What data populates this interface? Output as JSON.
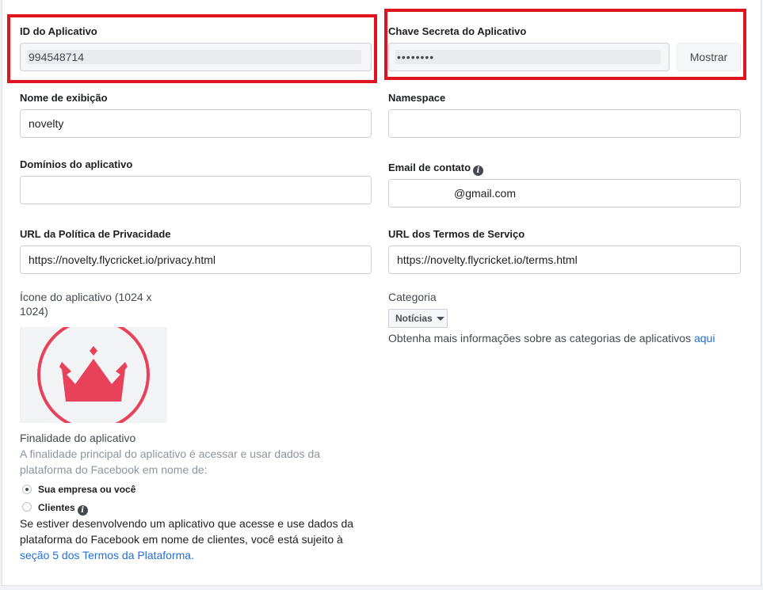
{
  "app_id": {
    "label": "ID do Aplicativo",
    "value": "994548714"
  },
  "app_secret": {
    "label": "Chave Secreta do Aplicativo",
    "value": "••••••••",
    "button": "Mostrar"
  },
  "display_name": {
    "label": "Nome de exibição",
    "value": "novelty"
  },
  "namespace": {
    "label": "Namespace",
    "value": ""
  },
  "app_domains": {
    "label": "Domínios do aplicativo",
    "value": ""
  },
  "contact_email": {
    "label": "Email de contato",
    "value": "@gmail.com"
  },
  "privacy_url": {
    "label": "URL da Política de Privacidade",
    "value": "https://novelty.flycricket.io/privacy.html"
  },
  "terms_url": {
    "label": "URL dos Termos de Serviço",
    "value": "https://novelty.flycricket.io/terms.html"
  },
  "app_icon": {
    "label": "Ícone do aplicativo (1024 x 1024)",
    "image": "crown-icon",
    "color": "#e8415a"
  },
  "category": {
    "label": "Categoria",
    "selected": "Notícias",
    "help_text": "Obtenha mais informações sobre as categorias de aplicativos",
    "help_link": "aqui"
  },
  "purpose": {
    "label": "Finalidade do aplicativo",
    "description": "A finalidade principal do aplicativo é acessar e usar dados da plataforma do Facebook em nome de:",
    "options": [
      {
        "label": "Sua empresa ou você",
        "checked": true
      },
      {
        "label": "Clientes",
        "checked": false
      }
    ],
    "note": "Se estiver desenvolvendo um aplicativo que acesse e use dados da plataforma do Facebook em nome de clientes, você está sujeito à",
    "note_link": "seção 5 dos Termos da Plataforma."
  },
  "colors": {
    "highlight": "#e0141e",
    "link": "#216fdb"
  }
}
